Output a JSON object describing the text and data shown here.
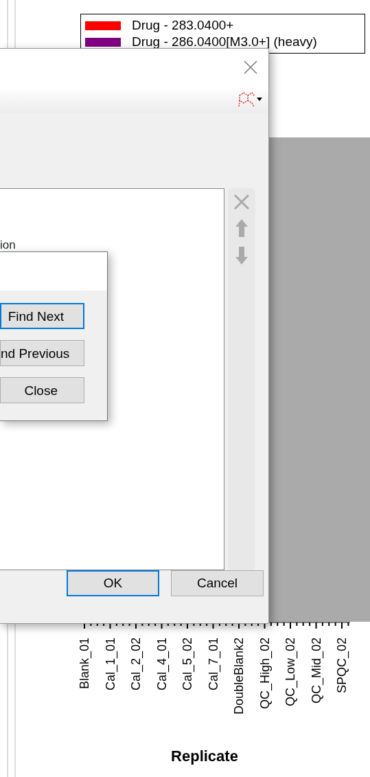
{
  "chart": {
    "legend": [
      {
        "label": "Drug - 283.0400+",
        "color": "#ff0000"
      },
      {
        "label": "Drug - 286.0400[M3.0+] (heavy)",
        "color": "#800080"
      }
    ],
    "x_labels": [
      "Blank_01",
      "Cal_1_01",
      "Cal_2_02",
      "Cal_4_01",
      "Cal_5_02",
      "Cal_7_01",
      "DoubleBlank2",
      "QC_High_02",
      "QC_Low_02",
      "QC_Mid_02",
      "SPQC_02"
    ],
    "xlabel": "Replicate"
  },
  "dialog": {
    "text": "ion",
    "buttons": [
      {
        "label": "OK",
        "focused": true
      },
      {
        "label": "Cancel",
        "focused": false
      }
    ]
  },
  "find_dialog": {
    "buttons": [
      {
        "label": "Find Next",
        "focused": true
      },
      {
        "label": "nd Previous",
        "focused": false
      },
      {
        "label": "Close",
        "focused": false
      }
    ]
  }
}
